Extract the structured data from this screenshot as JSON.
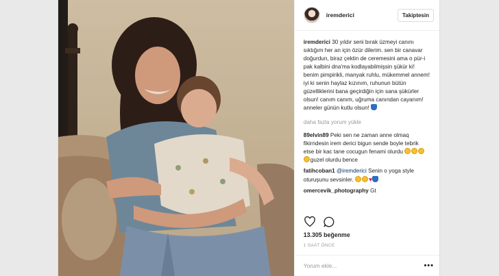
{
  "header": {
    "username": "iremderici",
    "follow_label": "Takiptesin"
  },
  "caption": {
    "username": "iremderici",
    "text": "30 yıldır seni bırak üzmeyi canını sıktığım her an için özür dilerim. sen bir canavar doğurdun, biraz çektin de ceremesini ama o pür-i pak kalbini dna'ma kodlayabilmişsin şükür ki! benim pimpirikli, manyak ruhlu, mükemmel annem! iyi ki senin haylaz kızınım, ruhunun bütün güzelliklerini bana geçirdiğin için sana şükürler olsun! canım canım, uğruma canından cayanım! anneler günün kutlu olsun!"
  },
  "load_more_label": "daha fazla yorum yükle",
  "comments": [
    {
      "username": "89elvin89",
      "text": "Peki sen ne zaman anne olmaq fikirndesin irem derici bigun sende boyle tebrik etse bir kac tane cocugun fenami olurdu",
      "tail": "guzel olurdu bence"
    },
    {
      "username": "fatihcoban1",
      "mention": "@iremderici",
      "text": "Senin o yoga style oturuşunu sevsinler."
    },
    {
      "username": "omercevik_photography",
      "text": "Gt"
    }
  ],
  "likes_label": "13.305 beğenme",
  "time_label": "1 SAAT ÖNCE",
  "comment_placeholder": "Yorum ekle...",
  "more_options": "•••",
  "colors": {
    "accent_link": "#003569",
    "muted": "#999999",
    "heart": "#e0245e"
  },
  "icons": [
    "heart-icon",
    "comment-icon",
    "more-options-icon"
  ]
}
